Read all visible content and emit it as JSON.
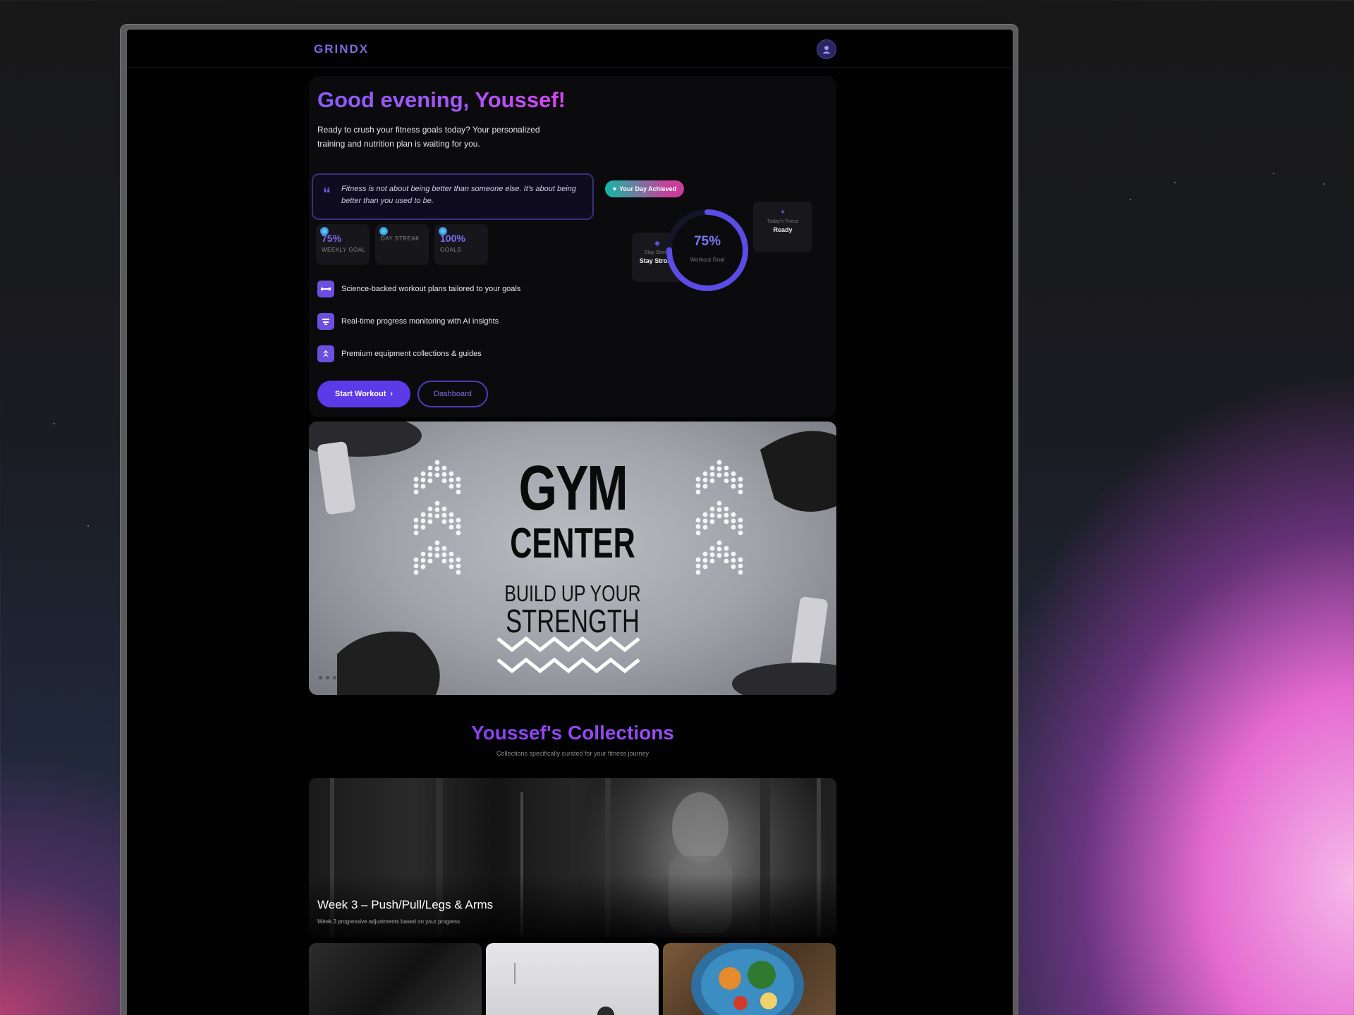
{
  "app": {
    "brand": "GRINDX"
  },
  "hero": {
    "greeting": "Good evening, Youssef!",
    "intro": "Ready to crush your fitness goals today? Your personalized training and nutrition plan is waiting for you.",
    "quote": "Fitness is not about being better than someone else. It's about being better than you used to be.",
    "badge": "Your Day Achieved",
    "stats": [
      {
        "value": "75%",
        "label": "WEEKLY GOAL"
      },
      {
        "value": "",
        "label": "DAY STREAK"
      },
      {
        "value": "100%",
        "label": "GOALS"
      }
    ],
    "features": [
      "Science-backed workout plans tailored to your goals",
      "Real-time progress monitoring with AI insights",
      "Premium equipment collections & guides"
    ],
    "primary_button": "Start Workout",
    "secondary_button": "Dashboard"
  },
  "ring_widget": {
    "percent": "75%",
    "progress": 0.75,
    "caption": "Workout Goal",
    "left_card": {
      "small": "Stay Strong",
      "bold": "Stay Strong"
    },
    "right_card": {
      "small": "Today's Focus",
      "bold": "Ready"
    }
  },
  "banner": {
    "title_line1": "GYM",
    "title_line2": "CENTER",
    "subtitle_line1": "BUILD UP YOUR",
    "subtitle_line2": "STRENGTH"
  },
  "collections": {
    "title": "Youssef's Collections",
    "subtitle": "Collections specifically curated for your fitness journey",
    "featured": {
      "title": "Week 3 – Push/Pull/Legs & Arms",
      "subtitle": "Week 3 progressive adjustments based on your progress"
    }
  },
  "colors": {
    "accent": "#6d4fe0",
    "brand": "#7b6ce0",
    "background": "#020203"
  },
  "icons": [
    "user-icon",
    "quote-icon",
    "heart-icon",
    "dumbbell-icon",
    "chart-icon",
    "equipment-icon",
    "chevron-right-icon",
    "droplet-icon"
  ]
}
